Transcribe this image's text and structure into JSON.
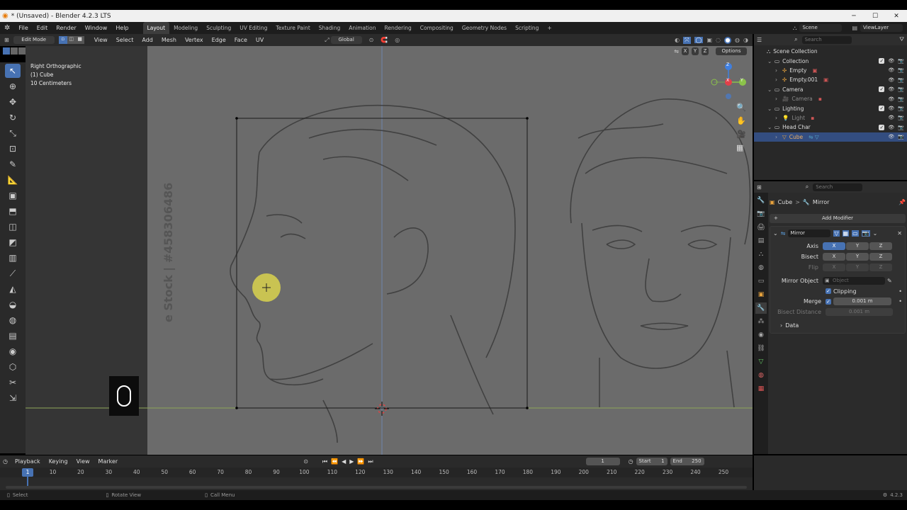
{
  "window": {
    "title": "* (Unsaved) - Blender 4.2.3 LTS",
    "minimize": "─",
    "maximize": "☐",
    "close": "✕"
  },
  "menu": {
    "items": [
      "File",
      "Edit",
      "Render",
      "Window",
      "Help"
    ]
  },
  "workspaces": {
    "tabs": [
      "Layout",
      "Modeling",
      "Sculpting",
      "UV Editing",
      "Texture Paint",
      "Shading",
      "Animation",
      "Rendering",
      "Compositing",
      "Geometry Nodes",
      "Scripting"
    ],
    "add": "+",
    "active": "Layout",
    "scene": "Scene",
    "viewlayer": "ViewLayer"
  },
  "viewport_header": {
    "mode": "Edit Mode",
    "menus": [
      "View",
      "Select",
      "Add",
      "Mesh",
      "Vertex",
      "Edge",
      "Face",
      "UV"
    ],
    "orientation": "Global",
    "options": "Options",
    "axes": [
      "X",
      "Y",
      "Z"
    ]
  },
  "viewport": {
    "view_name": "Right Orthographic",
    "object": "(1) Cube",
    "scale": "10 Centimeters",
    "watermark": "e Stock | #458306486",
    "gizmo": {
      "x": "X",
      "y": "Y",
      "z": "Z"
    }
  },
  "outliner": {
    "search": "Search",
    "rows": [
      {
        "label": "Scene Collection",
        "indent": 0,
        "type": "scene"
      },
      {
        "label": "Collection",
        "indent": 1,
        "type": "coll"
      },
      {
        "label": "Empty",
        "indent": 2,
        "type": "empty"
      },
      {
        "label": "Empty.001",
        "indent": 2,
        "type": "empty"
      },
      {
        "label": "Camera",
        "indent": 1,
        "type": "coll"
      },
      {
        "label": "Camera",
        "indent": 2,
        "type": "cam"
      },
      {
        "label": "Lighting",
        "indent": 1,
        "type": "coll"
      },
      {
        "label": "Light",
        "indent": 2,
        "type": "light"
      },
      {
        "label": "Head Char",
        "indent": 1,
        "type": "coll"
      },
      {
        "label": "Cube",
        "indent": 2,
        "type": "mesh",
        "selected": true
      }
    ]
  },
  "properties": {
    "search": "Search",
    "breadcrumb_object": "Cube",
    "breadcrumb_sep": ">",
    "breadcrumb_mod": "Mirror",
    "add_modifier": "Add Modifier",
    "modifier_name": "Mirror",
    "axis_label": "Axis",
    "bisect_label": "Bisect",
    "flip_label": "Flip",
    "xyz": [
      "X",
      "Y",
      "Z"
    ],
    "mirror_object_label": "Mirror Object",
    "mirror_object_placeholder": "Object",
    "clipping_label": "Clipping",
    "merge_label": "Merge",
    "merge_value": "0.001 m",
    "bisect_distance_label": "Bisect Distance",
    "bisect_distance_value": "0.001 m",
    "data_label": "Data"
  },
  "timeline": {
    "menus": [
      "Playback",
      "Keying",
      "View",
      "Marker"
    ],
    "current_frame": "1",
    "start_label": "Start",
    "start_value": "1",
    "end_label": "End",
    "end_value": "250",
    "ticks": [
      "10",
      "20",
      "30",
      "40",
      "50",
      "60",
      "70",
      "80",
      "90",
      "100",
      "110",
      "120",
      "130",
      "140",
      "150",
      "160",
      "170",
      "180",
      "190",
      "200",
      "210",
      "220",
      "230",
      "240",
      "250"
    ],
    "playhead": "1"
  },
  "statusbar": {
    "select": "Select",
    "rotate": "Rotate View",
    "menu": "Call Menu",
    "version": "4.2.3"
  },
  "colors": {
    "accent": "#4772b3",
    "viewport_bg": "#6b6b6b",
    "x_axis": "#e2404a",
    "y_axis": "#8bc34a",
    "z_axis": "#3f7fe0"
  }
}
